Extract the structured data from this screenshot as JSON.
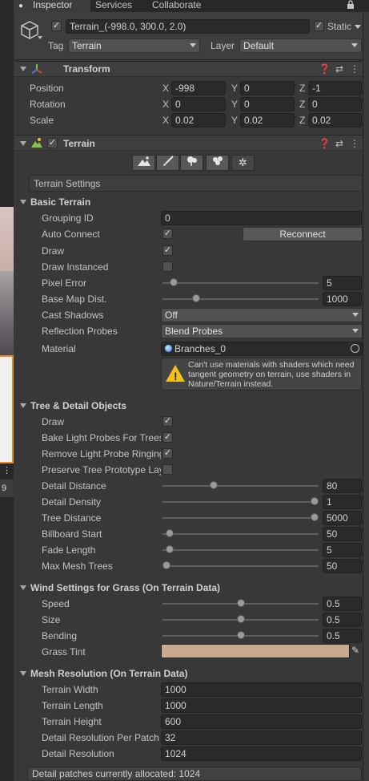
{
  "tabs": [
    "Inspector",
    "Services",
    "Collaborate"
  ],
  "header": {
    "object_name": "Terrain_(-998.0, 300.0, 2.0)",
    "static_label": "Static",
    "tag_label": "Tag",
    "tag_value": "Terrain",
    "layer_label": "Layer",
    "layer_value": "Default",
    "active": true,
    "static": true
  },
  "transform": {
    "title": "Transform",
    "rows": [
      {
        "label": "Position",
        "x": "-998",
        "y": "0",
        "z": "-1"
      },
      {
        "label": "Rotation",
        "x": "0",
        "y": "0",
        "z": "0"
      },
      {
        "label": "Scale",
        "x": "0.02",
        "y": "0.02",
        "z": "0.02"
      }
    ],
    "axes": [
      "X",
      "Y",
      "Z"
    ]
  },
  "terrain": {
    "title": "Terrain",
    "settings_title": "Terrain Settings",
    "tools": [
      "raise-terrain-icon",
      "paint-brush-icon",
      "tree-icon",
      "detail-icon",
      "gear-icon"
    ]
  },
  "basic": {
    "title": "Basic Terrain",
    "grouping_id_label": "Grouping ID",
    "grouping_id": "0",
    "auto_connect_label": "Auto Connect",
    "auto_connect": true,
    "reconnect": "Reconnect",
    "draw_label": "Draw",
    "draw": true,
    "draw_instanced_label": "Draw Instanced",
    "draw_instanced": false,
    "pixel_error_label": "Pixel Error",
    "pixel_error": "5",
    "pixel_error_fraction": 0.05,
    "base_map_label": "Base Map Dist.",
    "base_map": "1000",
    "base_map_fraction": 0.2,
    "cast_shadows_label": "Cast Shadows",
    "cast_shadows": "Off",
    "reflection_label": "Reflection Probes",
    "reflection": "Blend Probes",
    "material_label": "Material",
    "material": "Branches_0",
    "warning": "Can't use materials with shaders which need tangent geometry on terrain, use shaders in Nature/Terrain instead."
  },
  "tree": {
    "title": "Tree & Detail Objects",
    "draw_label": "Draw",
    "bake_label": "Bake Light Probes For Trees",
    "remove_label": "Remove Light Probe Ringing",
    "preserve_label": "Preserve Tree Prototype Layers",
    "draw": true,
    "bake": true,
    "remove": true,
    "preserve": false,
    "sliders": [
      {
        "label": "Detail Distance",
        "value": "80",
        "fraction": 0.32
      },
      {
        "label": "Detail Density",
        "value": "1",
        "fraction": 1.0
      },
      {
        "label": "Tree Distance",
        "value": "5000",
        "fraction": 1.0
      },
      {
        "label": "Billboard Start",
        "value": "50",
        "fraction": 0.02
      },
      {
        "label": "Fade Length",
        "value": "5",
        "fraction": 0.02
      },
      {
        "label": "Max Mesh Trees",
        "value": "50",
        "fraction": 0.0
      }
    ]
  },
  "wind": {
    "title": "Wind Settings for Grass (On Terrain Data)",
    "sliders": [
      {
        "label": "Speed",
        "value": "0.5",
        "fraction": 0.5
      },
      {
        "label": "Size",
        "value": "0.5",
        "fraction": 0.5
      },
      {
        "label": "Bending",
        "value": "0.5",
        "fraction": 0.5
      }
    ],
    "grass_tint_label": "Grass Tint",
    "grass_tint_color": "#c8aa91"
  },
  "mesh": {
    "title": "Mesh Resolution (On Terrain Data)",
    "rows": [
      {
        "label": "Terrain Width",
        "value": "1000"
      },
      {
        "label": "Terrain Length",
        "value": "1000"
      },
      {
        "label": "Terrain Height",
        "value": "600"
      },
      {
        "label": "Detail Resolution Per Patch",
        "value": "32"
      },
      {
        "label": "Detail Resolution",
        "value": "1024"
      }
    ]
  },
  "status": "Detail patches currently allocated: 1024",
  "side": {
    "fragment": "9"
  }
}
